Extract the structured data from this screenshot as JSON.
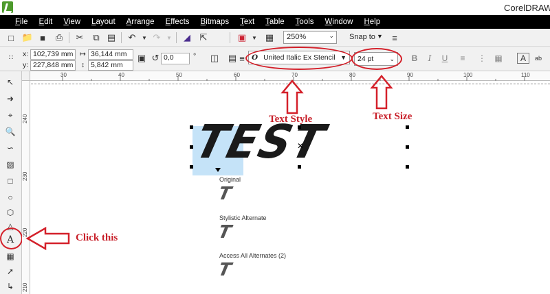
{
  "window": {
    "title": "CorelDRAW"
  },
  "menu": [
    "File",
    "Edit",
    "View",
    "Layout",
    "Arrange",
    "Effects",
    "Bitmaps",
    "Text",
    "Table",
    "Tools",
    "Window",
    "Help"
  ],
  "toolbar": {
    "zoom": "250%",
    "snap_label": "Snap to"
  },
  "property_bar": {
    "x_label": "x:",
    "x_value": "102,739 mm",
    "y_label": "y:",
    "y_value": "227,848 mm",
    "width_value": "36,144 mm",
    "height_value": "5,842 mm",
    "rotation_value": "0,0",
    "rotation_unit": "°",
    "font_name": "United Italic Ex Stencil",
    "font_size": "24 pt"
  },
  "ruler": {
    "h_labels": [
      "30",
      "40",
      "50",
      "60",
      "70",
      "80",
      "90",
      "100",
      "110"
    ],
    "v_labels": [
      "240",
      "230",
      "220",
      "210"
    ]
  },
  "canvas": {
    "main_text": "TEST",
    "alternates": [
      {
        "label": "Original",
        "glyph": "T"
      },
      {
        "label": "Stylistic Alternate",
        "glyph": "T"
      },
      {
        "label": "Access All Alternates (2)",
        "glyph": "T"
      }
    ]
  },
  "annotations": {
    "text_style": "Text Style",
    "text_size": "Text Size",
    "click_this": "Click this"
  },
  "colors": {
    "annotation_red": "#c8202a",
    "menubar_bg": "#000000",
    "selection_blue": "#c5e3f8"
  }
}
